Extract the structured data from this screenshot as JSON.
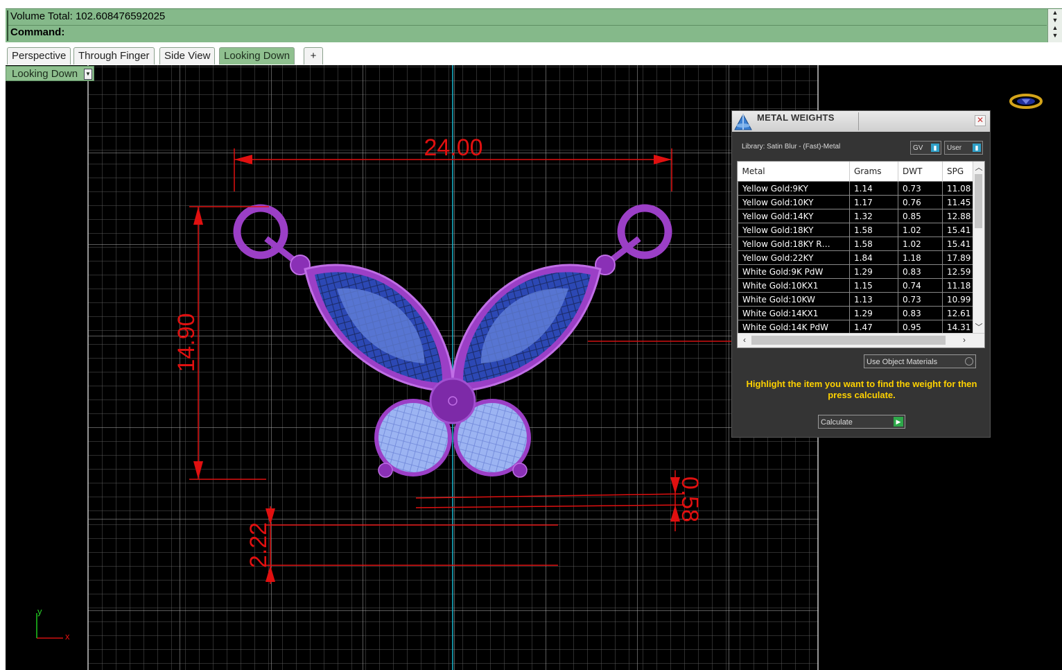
{
  "command_area": {
    "volume_line": "Volume Total:  102.608476592025",
    "command_prompt": "Command:"
  },
  "tabs": [
    {
      "label": "Perspective"
    },
    {
      "label": "Through Finger"
    },
    {
      "label": "Side View"
    },
    {
      "label": "Looking Down",
      "active": true
    },
    {
      "label": "+"
    }
  ],
  "viewport": {
    "label": "Looking Down",
    "dimensions": {
      "width": "24.00",
      "height": "14.90",
      "small_gap": "0.58",
      "bottom_gap": "2.22"
    },
    "axis": {
      "y": "y",
      "x": "x"
    }
  },
  "panel": {
    "title": "METAL WEIGHTS",
    "library": "Library: Satin Blur - (Fast)-Metal",
    "gv_label": "GV",
    "user_label": "User",
    "columns": [
      "Metal",
      "Grams",
      "DWT",
      "SPG"
    ],
    "rows": [
      [
        "Yellow Gold:9KY",
        "1.14",
        "0.73",
        "11.08"
      ],
      [
        "Yellow Gold:10KY",
        "1.17",
        "0.76",
        "11.45"
      ],
      [
        "Yellow Gold:14KY",
        "1.32",
        "0.85",
        "12.88"
      ],
      [
        "Yellow Gold:18KY",
        "1.58",
        "1.02",
        "15.41"
      ],
      [
        "Yellow Gold:18KY R…",
        "1.58",
        "1.02",
        "15.41"
      ],
      [
        "Yellow Gold:22KY",
        "1.84",
        "1.18",
        "17.89"
      ],
      [
        "White Gold:9K PdW",
        "1.29",
        "0.83",
        "12.59"
      ],
      [
        "White Gold:10KX1",
        "1.15",
        "0.74",
        "11.18"
      ],
      [
        "White Gold:10KW",
        "1.13",
        "0.73",
        "10.99"
      ],
      [
        "White Gold:14KX1",
        "1.29",
        "0.83",
        "12.61"
      ],
      [
        "White Gold:14K PdW",
        "1.47",
        "0.95",
        "14.31"
      ]
    ],
    "use_object_materials": "Use Object Materials",
    "hint": "Highlight the item you want to find the weight for then press calculate.",
    "calculate_label": "Calculate"
  },
  "colors": {
    "command_bg": "#85b98a",
    "dimension": "#e01010",
    "metal": "#a040c8",
    "gem": "#3c5ec8",
    "grid": "#9a9a9a",
    "hint": "#ffd200"
  }
}
